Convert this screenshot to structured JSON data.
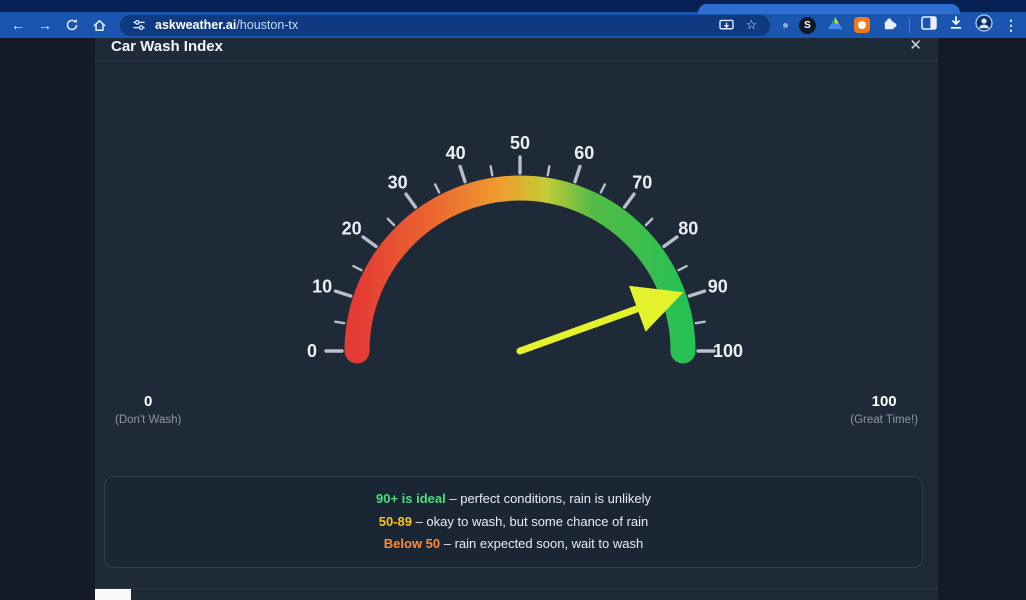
{
  "browser": {
    "url": {
      "domain": "askweather.ai",
      "path": "/houston-tx"
    }
  },
  "icons": {
    "back": "←",
    "forward": "→",
    "star": "☆",
    "menu": "⋮",
    "close": "✕",
    "s_badge": "S"
  },
  "modal": {
    "title": "Car Wash Index"
  },
  "chart_data": {
    "type": "gauge",
    "title": "Car Wash Index",
    "min": 0,
    "max": 100,
    "value": 89,
    "major_tick_step": 10,
    "minor_tick_step": 5,
    "tick_labels": [
      "0",
      "10",
      "20",
      "30",
      "40",
      "50",
      "60",
      "70",
      "80",
      "90",
      "100"
    ],
    "start_angle_deg": 180,
    "end_angle_deg": 0,
    "needle_color": "#e3f22c",
    "tick_color": "#b7bfca",
    "label_color": "#eceff4",
    "gradient": [
      {
        "offset": "0%",
        "color": "#e43b35"
      },
      {
        "offset": "25%",
        "color": "#ec6a30"
      },
      {
        "offset": "45%",
        "color": "#eea030"
      },
      {
        "offset": "58%",
        "color": "#c3cc35"
      },
      {
        "offset": "72%",
        "color": "#55bb47"
      },
      {
        "offset": "100%",
        "color": "#27c153"
      }
    ],
    "endpoints": {
      "left": {
        "value": "0",
        "caption": "(Don't Wash)"
      },
      "right": {
        "value": "100",
        "caption": "(Great Time!)"
      }
    }
  },
  "legend": {
    "lines": [
      {
        "highlight": "90+ is ideal",
        "rest": " – perfect conditions, rain is unlikely",
        "color": "#4ade80"
      },
      {
        "highlight": "50-89",
        "rest": " – okay to wash, but some chance of rain",
        "color": "#f5c518"
      },
      {
        "highlight": "Below 50",
        "rest": " – rain expected soon, wait to wash",
        "color": "#fb8c3a"
      }
    ]
  }
}
